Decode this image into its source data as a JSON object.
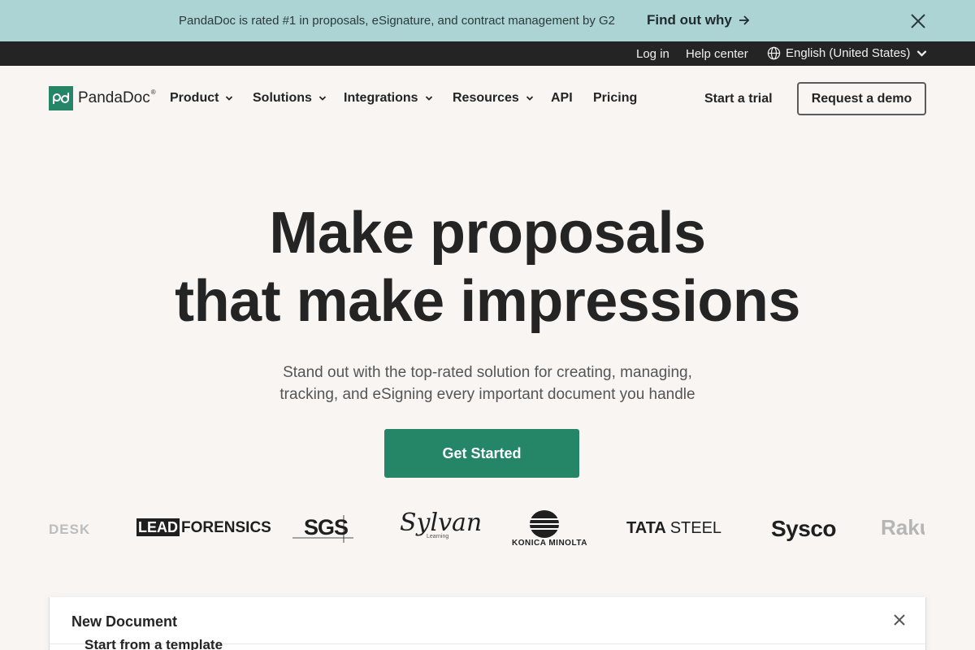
{
  "promo": {
    "text": "PandaDoc is rated #1 in proposals, eSignature, and contract management by G2",
    "link": "Find out why"
  },
  "topbar": {
    "login": "Log in",
    "help": "Help center",
    "language": "English (United States)"
  },
  "nav": {
    "logo_text": "PandaDoc",
    "logo_mark": "®",
    "items": [
      {
        "label": "Product",
        "dropdown": true
      },
      {
        "label": "Solutions",
        "dropdown": true
      },
      {
        "label": "Integrations",
        "dropdown": true
      },
      {
        "label": "Resources",
        "dropdown": true
      },
      {
        "label": "API",
        "dropdown": false
      },
      {
        "label": "Pricing",
        "dropdown": false
      }
    ],
    "trial": "Start a trial",
    "demo": "Request a demo"
  },
  "hero": {
    "title_line1": "Make proposals",
    "title_line2": "that make impressions",
    "subtitle_line1": "Stand out with the top-rated solution for creating, managing,",
    "subtitle_line2": "tracking, and eSigning every important document you handle",
    "cta": "Get Started"
  },
  "logos": {
    "brands": [
      "DESK",
      "LEADFORENSICS",
      "SGS",
      "Sylvan",
      "KONICA MINOLTA",
      "TATA STEEL",
      "Sysco",
      "Raku"
    ],
    "lead": "LEAD",
    "forensics": "FORENSICS",
    "sylvan_sub": "Learning",
    "tata": "TATA",
    "steel": "STEEL"
  },
  "modal": {
    "title": "New Document",
    "subtitle": "Start from a template"
  },
  "colors": {
    "brand_green": "#248567",
    "promo_bg": "#acd4d5",
    "topbar_bg": "#242424",
    "page_bg": "#f8f5f3"
  }
}
